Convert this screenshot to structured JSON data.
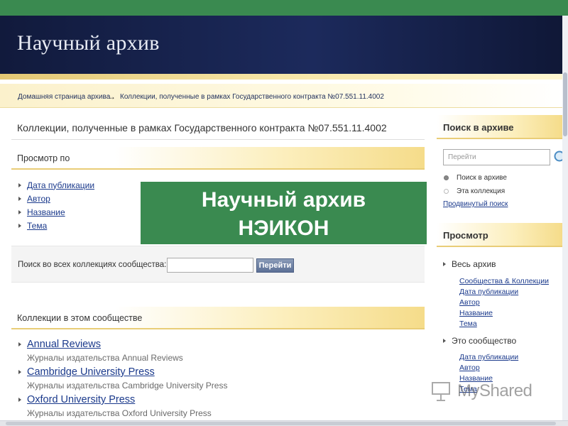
{
  "header": {
    "title": "Научный архив"
  },
  "breadcrumb": {
    "home": "Домашняя страница архива",
    "arrow": "→",
    "current": "Коллекции, полученные в рамках Государственного контракта №07.551.11.4002"
  },
  "main": {
    "page_title": "Коллекции, полученные в рамках Государственного контракта №07.551.11.4002",
    "browse_heading": "Просмотр по",
    "browse_items": [
      "Дата публикации",
      "Автор",
      "Название",
      "Тема"
    ],
    "search_label": "Поиск во всех коллекциях сообщества:",
    "search_value": "",
    "search_button": "Перейти",
    "collections_heading": "Коллекции в этом сообществе",
    "collections": [
      {
        "title": "Annual Reviews",
        "desc": "Журналы издательства Annual Reviews"
      },
      {
        "title": "Cambridge University Press",
        "desc": "Журналы издательства Cambridge University Press"
      },
      {
        "title": "Oxford University Press",
        "desc": "Журналы издательства Oxford University Press"
      }
    ]
  },
  "sidebar": {
    "search_heading": "Поиск в архиве",
    "search_placeholder": "Перейти",
    "radio_all": "Поиск в архиве",
    "radio_collection": "Эта коллекция",
    "advanced_link": "Продвинутый поиск",
    "browse_heading": "Просмотр",
    "group_all": "Весь архив",
    "group_all_items": [
      "Сообщества & Коллекции",
      "Дата публикации",
      "Автор",
      "Название",
      "Тема"
    ],
    "group_community": "Это сообщество",
    "group_community_items": [
      "Дата публикации",
      "Автор",
      "Название",
      "Тема"
    ]
  },
  "overlay": {
    "line1": "Научный архив",
    "line2": "НЭИКОН"
  },
  "watermark": {
    "text": "MyShared"
  }
}
